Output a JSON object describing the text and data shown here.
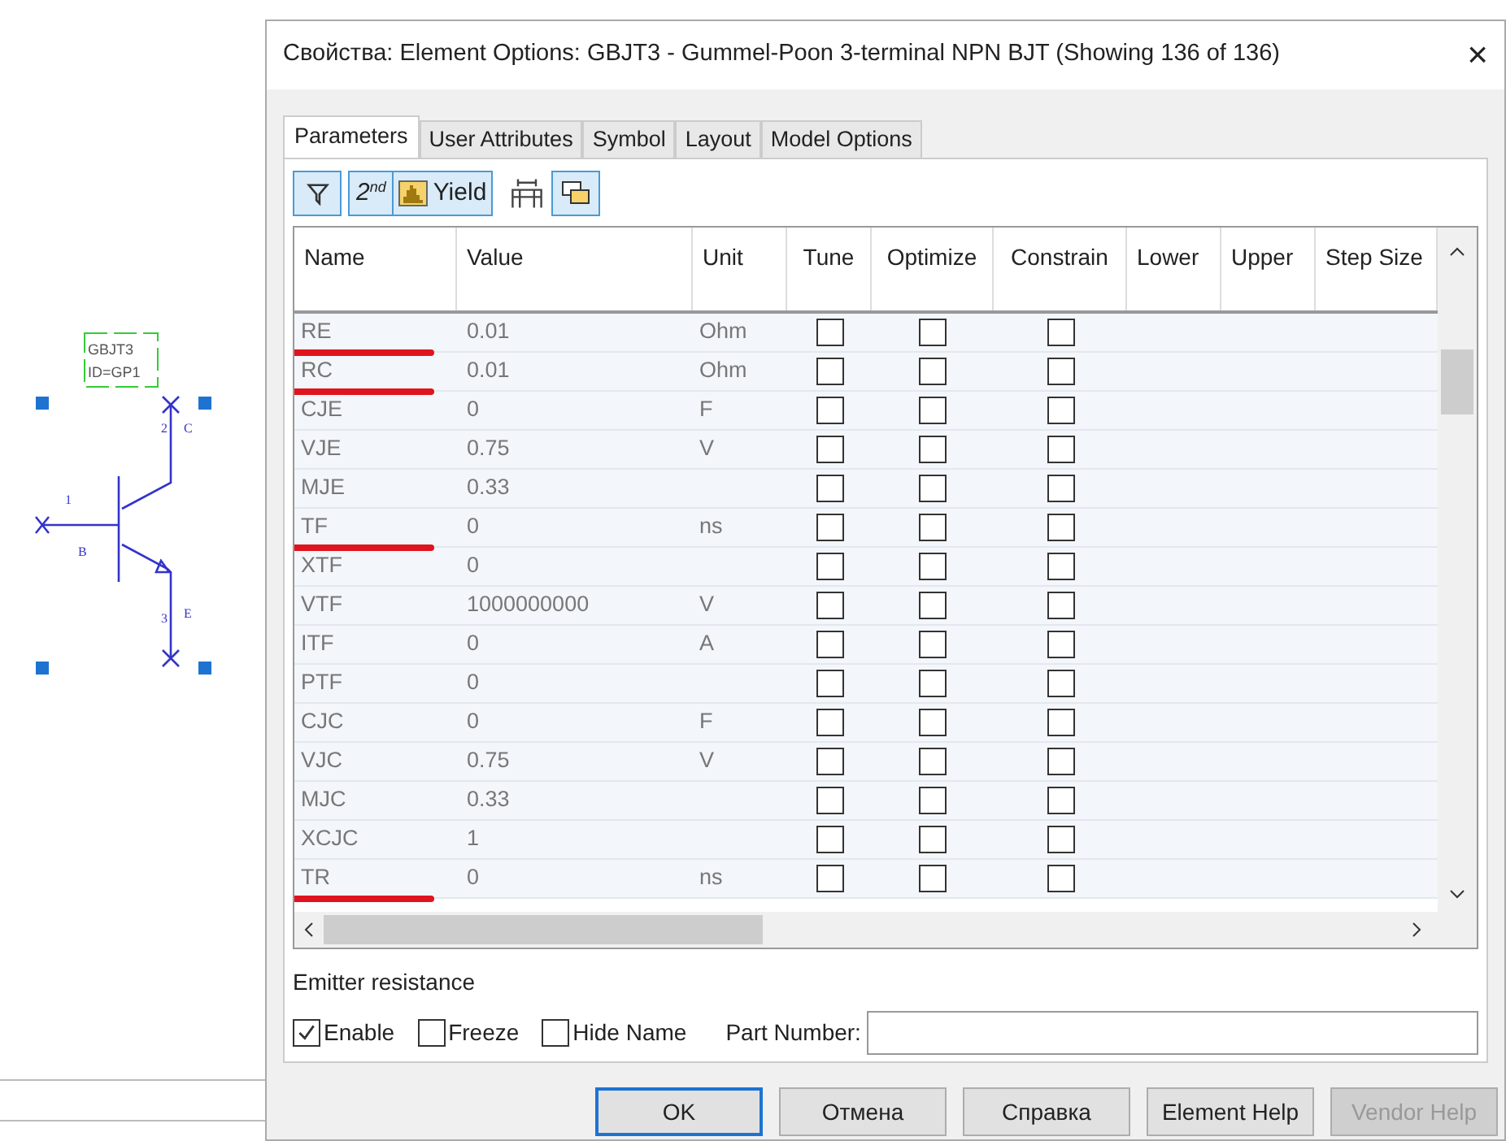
{
  "schematic": {
    "name": "GBJT3",
    "id": "ID=GP1",
    "pins": [
      {
        "number": "1",
        "label": "B"
      },
      {
        "number": "2",
        "label": "C"
      },
      {
        "number": "3",
        "label": "E"
      }
    ]
  },
  "window": {
    "title": "Свойства: Element Options: GBJT3 - Gummel-Poon 3-terminal NPN BJT (Showing 136 of 136)",
    "close": "×"
  },
  "tabs": [
    {
      "label": "Parameters",
      "selected": true
    },
    {
      "label": "User Attributes",
      "selected": false
    },
    {
      "label": "Symbol",
      "selected": false
    },
    {
      "label": "Layout",
      "selected": false
    },
    {
      "label": "Model Options",
      "selected": false
    }
  ],
  "toolbar": {
    "second_label": "2",
    "second_sup": "nd",
    "yield": "Yield"
  },
  "table": {
    "columns": [
      "Name",
      "Value",
      "Unit",
      "Tune",
      "Optimize",
      "Constrain",
      "Lower",
      "Upper",
      "Step Size"
    ],
    "rows": [
      {
        "name": "RE",
        "value": "0.01",
        "unit": "Ohm",
        "tune": false,
        "optimize": false,
        "constrain": false,
        "underlined": true
      },
      {
        "name": "RC",
        "value": "0.01",
        "unit": "Ohm",
        "tune": false,
        "optimize": false,
        "constrain": false,
        "underlined": true
      },
      {
        "name": "CJE",
        "value": "0",
        "unit": "F",
        "tune": false,
        "optimize": false,
        "constrain": false,
        "underlined": false
      },
      {
        "name": "VJE",
        "value": "0.75",
        "unit": "V",
        "tune": false,
        "optimize": false,
        "constrain": false,
        "underlined": false
      },
      {
        "name": "MJE",
        "value": "0.33",
        "unit": "",
        "tune": false,
        "optimize": false,
        "constrain": false,
        "underlined": false
      },
      {
        "name": "TF",
        "value": "0",
        "unit": "ns",
        "tune": false,
        "optimize": false,
        "constrain": false,
        "underlined": true
      },
      {
        "name": "XTF",
        "value": "0",
        "unit": "",
        "tune": false,
        "optimize": false,
        "constrain": false,
        "underlined": false
      },
      {
        "name": "VTF",
        "value": "1000000000",
        "unit": "V",
        "tune": false,
        "optimize": false,
        "constrain": false,
        "underlined": false
      },
      {
        "name": "ITF",
        "value": "0",
        "unit": "A",
        "tune": false,
        "optimize": false,
        "constrain": false,
        "underlined": false
      },
      {
        "name": "PTF",
        "value": "0",
        "unit": "",
        "tune": false,
        "optimize": false,
        "constrain": false,
        "underlined": false
      },
      {
        "name": "CJC",
        "value": "0",
        "unit": "F",
        "tune": false,
        "optimize": false,
        "constrain": false,
        "underlined": false
      },
      {
        "name": "VJC",
        "value": "0.75",
        "unit": "V",
        "tune": false,
        "optimize": false,
        "constrain": false,
        "underlined": false
      },
      {
        "name": "MJC",
        "value": "0.33",
        "unit": "",
        "tune": false,
        "optimize": false,
        "constrain": false,
        "underlined": false
      },
      {
        "name": "XCJC",
        "value": "1",
        "unit": "",
        "tune": false,
        "optimize": false,
        "constrain": false,
        "underlined": false
      },
      {
        "name": "TR",
        "value": "0",
        "unit": "ns",
        "tune": false,
        "optimize": false,
        "constrain": false,
        "underlined": true
      }
    ]
  },
  "description": "Emitter resistance",
  "options": [
    {
      "label": "Enable",
      "checked": true
    },
    {
      "label": "Freeze",
      "checked": false
    },
    {
      "label": "Hide Name",
      "checked": false
    }
  ],
  "part_number": {
    "label": "Part Number:"
  },
  "buttons": [
    {
      "label": "OK",
      "default": true,
      "disabled": false
    },
    {
      "label": "Отмена",
      "default": false,
      "disabled": false
    },
    {
      "label": "Справка",
      "default": false,
      "disabled": false
    },
    {
      "label": "Element Help",
      "default": false,
      "disabled": false
    },
    {
      "label": "Vendor Help",
      "default": false,
      "disabled": true
    }
  ]
}
